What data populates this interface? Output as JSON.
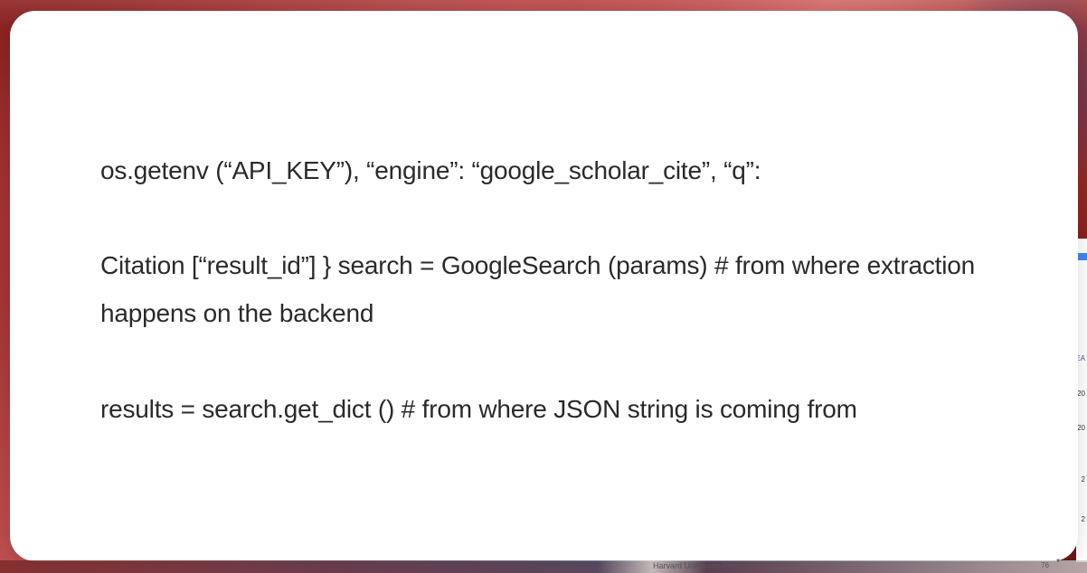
{
  "content": {
    "paragraphs": [
      "os.getenv (“API_KEY”), “engine”: “google_scholar_cite”, “q”:",
      "Citation [“result_id”] } search = GoogleSearch (params) # from where ex­traction happens on the backend",
      "results = search.get_dict () # from where JSON string is coming from"
    ]
  },
  "background": {
    "publisher_label": "Harvard University Press",
    "corner_number": "76",
    "right_markers": {
      "year_fragment_1": "EA",
      "year_fragment_2": "20",
      "year_fragment_3": "20",
      "year_fragment_4": "2",
      "year_fragment_5": "2"
    }
  }
}
